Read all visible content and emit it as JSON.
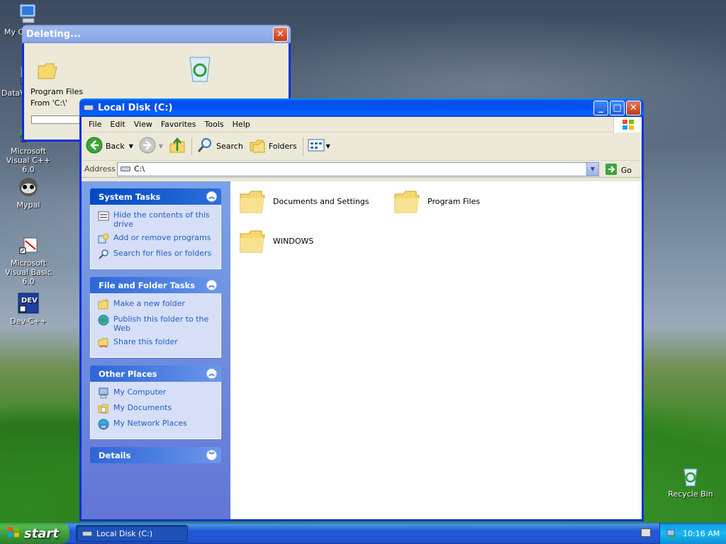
{
  "desktop": {
    "icons": [
      {
        "label": "My C",
        "icon": "my-computer-icon"
      },
      {
        "label": "DataV",
        "icon": "shortcut-icon"
      },
      {
        "label": "Microsoft Visual C++ 6.0",
        "icon": "visual-cpp-icon"
      },
      {
        "label": "Mypal",
        "icon": "mypal-icon"
      },
      {
        "label": "Microsoft Visual Basic 6.0",
        "icon": "visual-basic-icon"
      },
      {
        "label": "Dev-C++",
        "icon": "dev-cpp-icon"
      }
    ],
    "recycle_bin": "Recycle Bin"
  },
  "deleting_dialog": {
    "title": "Deleting...",
    "item": "Program Files",
    "from": "From 'C:\\'"
  },
  "explorer": {
    "title": "Local Disk (C:)",
    "menu": [
      "File",
      "Edit",
      "View",
      "Favorites",
      "Tools",
      "Help"
    ],
    "toolbar": {
      "back": "Back",
      "search": "Search",
      "folders": "Folders"
    },
    "address_label": "Address",
    "address_value": "C:\\",
    "go_label": "Go",
    "system_tasks": {
      "title": "System Tasks",
      "items": [
        "Hide the contents of this drive",
        "Add or remove programs",
        "Search for files or folders"
      ]
    },
    "file_folder_tasks": {
      "title": "File and Folder Tasks",
      "items": [
        "Make a new folder",
        "Publish this folder to the Web",
        "Share this folder"
      ]
    },
    "other_places": {
      "title": "Other Places",
      "items": [
        "My Computer",
        "My Documents",
        "My Network Places"
      ]
    },
    "details": {
      "title": "Details"
    },
    "folders": [
      "Documents and Settings",
      "Program Files",
      "WINDOWS"
    ]
  },
  "taskbar": {
    "start_label": "start",
    "task_button": "Local Disk (C:)",
    "clock": "10:16 AM"
  }
}
